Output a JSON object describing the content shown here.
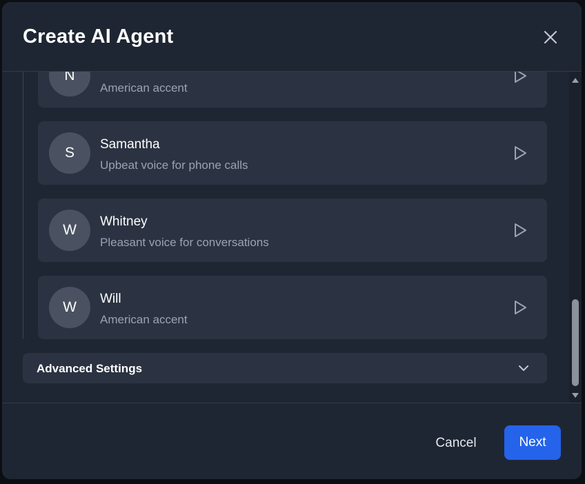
{
  "modal": {
    "title": "Create AI Agent"
  },
  "voices": [
    {
      "initial": "N",
      "name": "",
      "description": "American accent"
    },
    {
      "initial": "S",
      "name": "Samantha",
      "description": "Upbeat voice for phone calls"
    },
    {
      "initial": "W",
      "name": "Whitney",
      "description": "Pleasant voice for conversations"
    },
    {
      "initial": "W",
      "name": "Will",
      "description": "American accent"
    }
  ],
  "advanced_settings": {
    "label": "Advanced Settings"
  },
  "footer": {
    "cancel_label": "Cancel",
    "next_label": "Next"
  },
  "colors": {
    "accent": "#2563eb",
    "modal_bg": "#1f2633",
    "card_bg": "#2b3342",
    "avatar_bg": "#4a5262"
  },
  "icons": {
    "close": "close-icon",
    "play": "play-icon",
    "chevron": "chevron-down-icon"
  }
}
